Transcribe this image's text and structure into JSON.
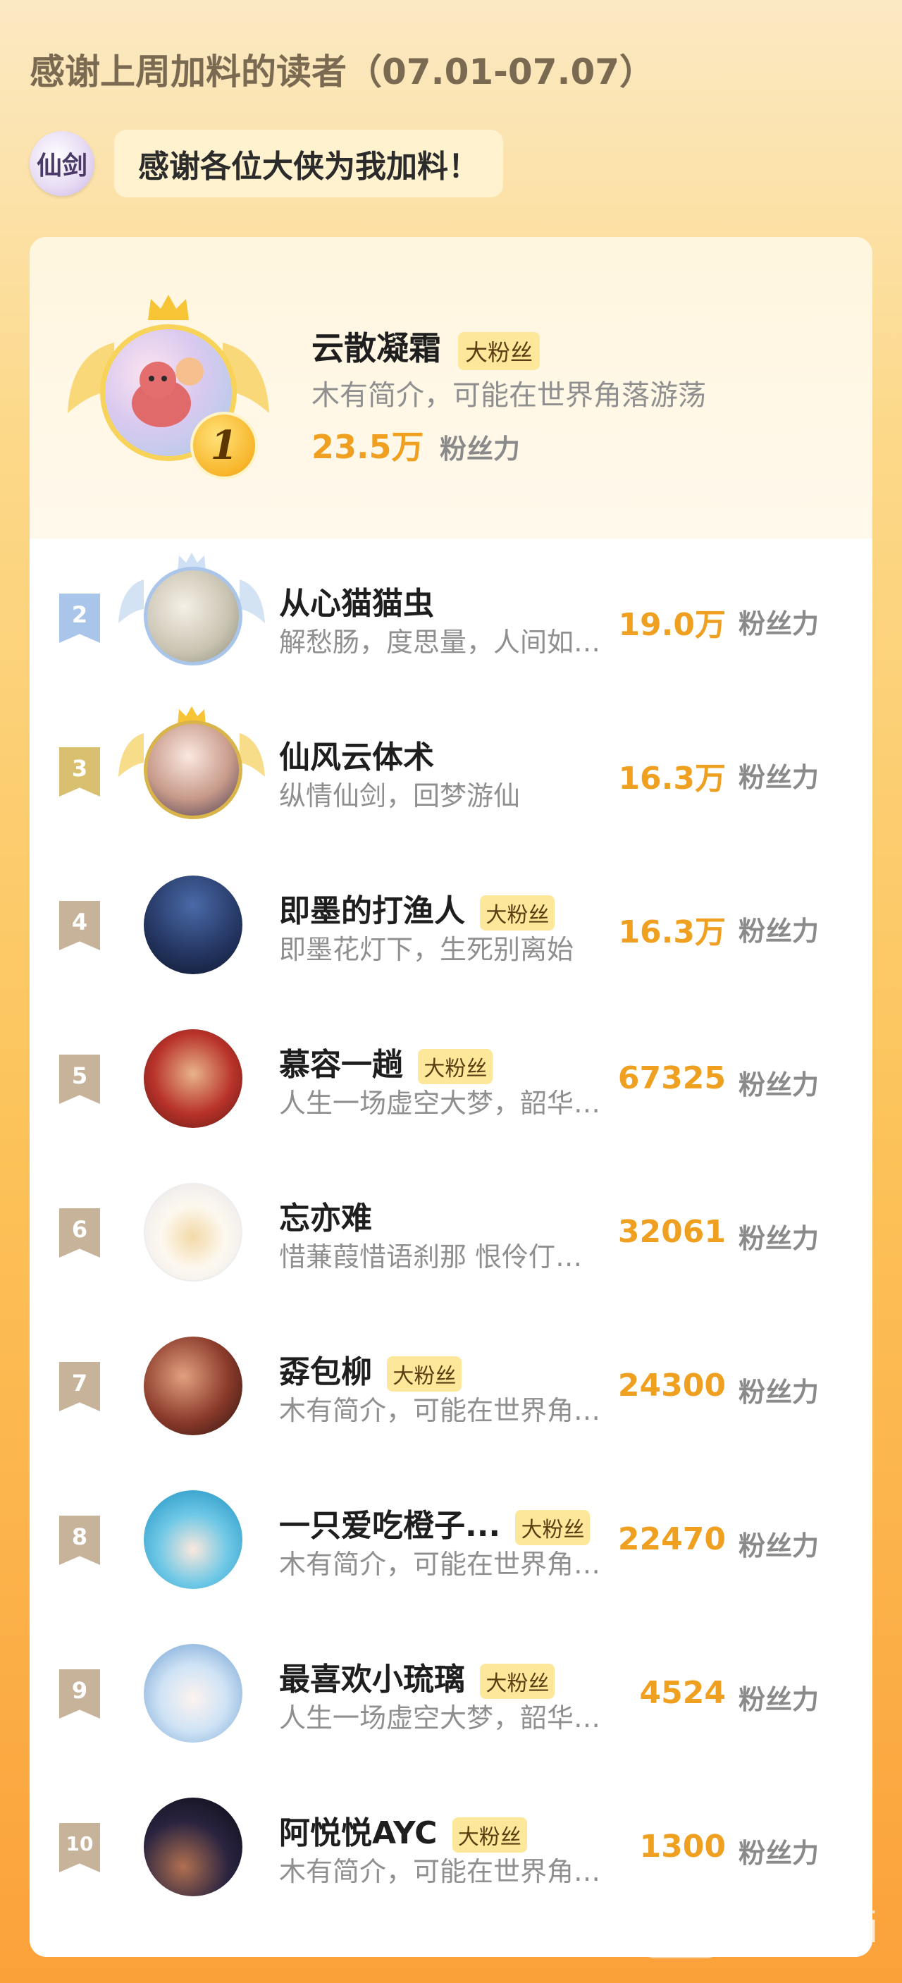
{
  "header": {
    "title": "感谢上周加料的读者（07.01-07.07）",
    "logo_text": "仙剑",
    "speech": "感谢各位大侠为我加料！"
  },
  "unit_label": "粉丝力",
  "top_reader": {
    "rank": "1",
    "name": "云散凝霜",
    "badge": "大粉丝",
    "description": "木有简介，可能在世界角落游荡",
    "points": "23.5万",
    "unit": "粉丝力"
  },
  "readers": [
    {
      "rank": "2",
      "name": "从心猫猫虫",
      "badge": "",
      "description": "解愁肠，度思量，人间如…",
      "points": "19.0万",
      "unit": "粉丝力"
    },
    {
      "rank": "3",
      "name": "仙风云体术",
      "badge": "",
      "description": "纵情仙剑，回梦游仙",
      "points": "16.3万",
      "unit": "粉丝力"
    },
    {
      "rank": "4",
      "name": "即墨的打渔人",
      "badge": "大粉丝",
      "description": "即墨花灯下，生死别离始",
      "points": "16.3万",
      "unit": "粉丝力"
    },
    {
      "rank": "5",
      "name": "慕容一趟",
      "badge": "大粉丝",
      "description": "人生一场虚空大梦，韶华…",
      "points": "67325",
      "unit": "粉丝力"
    },
    {
      "rank": "6",
      "name": "忘亦难",
      "badge": "",
      "description": "惜蒹葭惜语刹那 恨伶仃…",
      "points": "32061",
      "unit": "粉丝力"
    },
    {
      "rank": "7",
      "name": "孬包柳",
      "badge": "大粉丝",
      "description": "木有简介，可能在世界角…",
      "points": "24300",
      "unit": "粉丝力"
    },
    {
      "rank": "8",
      "name": "一只爱吃橙子...",
      "badge": "大粉丝",
      "description": "木有简介，可能在世界角…",
      "points": "22470",
      "unit": "粉丝力"
    },
    {
      "rank": "9",
      "name": "最喜欢小琉璃",
      "badge": "大粉丝",
      "description": "人生一场虚空大梦，韶华…",
      "points": "4524",
      "unit": "粉丝力"
    },
    {
      "rank": "10",
      "name": "阿悦悦AYC",
      "badge": "大粉丝",
      "description": "木有简介，可能在世界角…",
      "points": "1300",
      "unit": "粉丝力"
    }
  ],
  "watermark": {
    "box_text": "快看!",
    "text": "快看漫画"
  },
  "colors": {
    "points": "#f0a020",
    "badge_bg": "#fde79b",
    "rank_2": "#a9c6ea",
    "rank_3": "#d8c070",
    "rank_other": "#c7b29a"
  }
}
